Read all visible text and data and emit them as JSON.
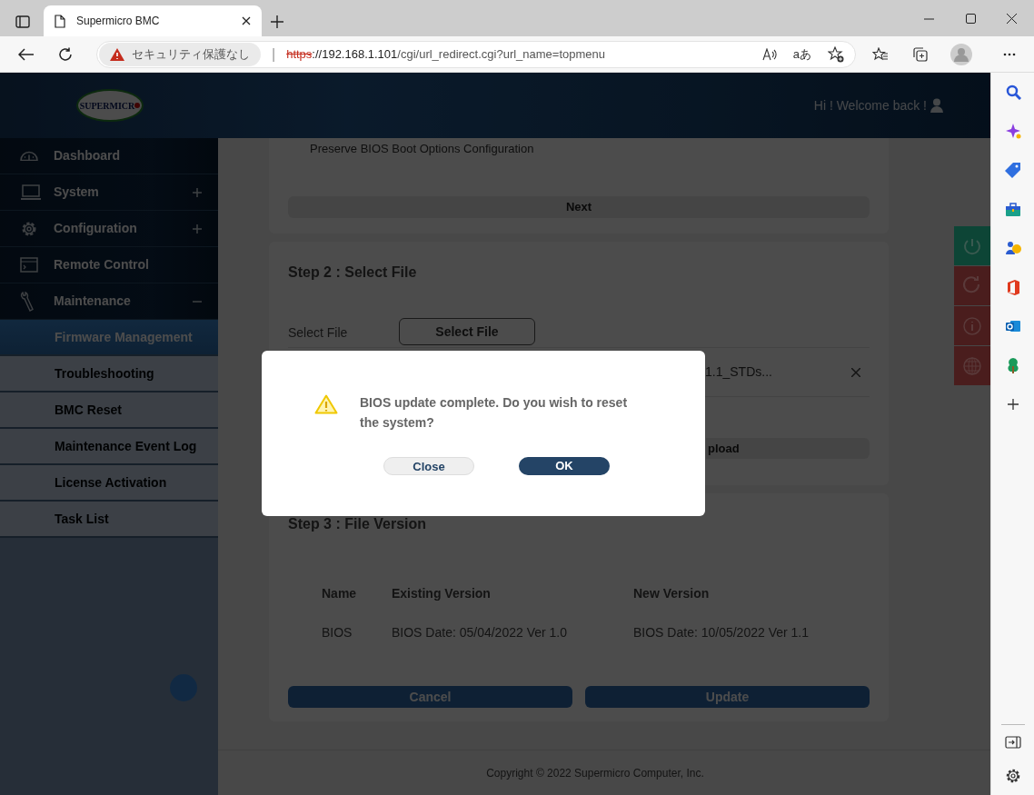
{
  "browser": {
    "tab_title": "Supermicro BMC",
    "security_label": "セキュリティ保護なし",
    "url_scheme": "https",
    "url_rest": "://192.168.1.101/cgi/url_redirect.cgi?url_name=topmenu",
    "separator": "|",
    "translate_label": "aあ"
  },
  "header": {
    "logo_text": "SUPERMICR",
    "greeting": "Hi ! Welcome back !"
  },
  "sidebar": {
    "items": [
      {
        "label": "Dashboard",
        "selected": false
      },
      {
        "label": "System",
        "selected": false,
        "expanded": false
      },
      {
        "label": "Configuration",
        "selected": false,
        "expanded": false
      },
      {
        "label": "Remote Control",
        "selected": false
      },
      {
        "label": "Maintenance",
        "selected": false,
        "expanded": true,
        "children": [
          {
            "label": "Firmware Management",
            "selected": true
          },
          {
            "label": "Troubleshooting",
            "selected": false
          },
          {
            "label": "BMC Reset",
            "selected": false
          },
          {
            "label": "Maintenance Event Log",
            "selected": false
          },
          {
            "label": "License Activation",
            "selected": false
          },
          {
            "label": "Task List",
            "selected": false
          }
        ]
      }
    ]
  },
  "step1": {
    "option_label": "Preserve BIOS Boot Options Configuration",
    "next_button": "Next"
  },
  "step2": {
    "title": "Step 2 : Select File",
    "field_label": "Select File",
    "select_button": "Select File",
    "file_name": "1.1_STDs...",
    "upload_button": "pload"
  },
  "step3": {
    "title": "Step 3 : File Version",
    "columns": [
      "Name",
      "Existing Version",
      "New Version"
    ],
    "rows": [
      [
        "BIOS",
        "BIOS Date: 05/04/2022 Ver 1.0",
        "BIOS Date: 10/05/2022 Ver 1.1"
      ]
    ],
    "cancel_button": "Cancel",
    "update_button": "Update"
  },
  "quick_actions": [
    {
      "color": "#0d4536"
    },
    {
      "color": "#4a1d1d"
    },
    {
      "color": "#4a1d1d"
    },
    {
      "color": "#4a1d1d"
    }
  ],
  "footer": {
    "copyright": "Copyright © 2022 Supermicro Computer, Inc."
  },
  "dialog": {
    "message": "BIOS update complete. Do you wish to reset the system?",
    "close_button": "Close",
    "ok_button": "OK"
  }
}
